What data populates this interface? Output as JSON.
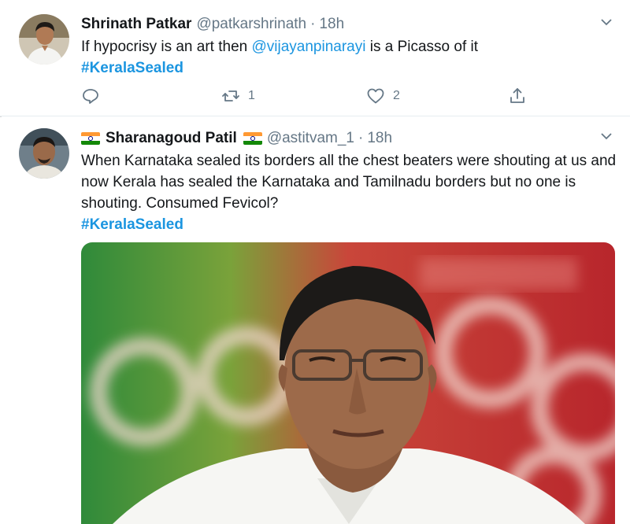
{
  "tweets": [
    {
      "name": "Shrinath Patkar",
      "handle": "@patkarshrinath",
      "separator": "·",
      "time": "18h",
      "text_before": "If hypocrisy is an art then ",
      "mention": "@vijayanpinarayi",
      "text_after": " is a Picasso of it",
      "hashtag": "#KeralaSealed",
      "retweets": "1",
      "likes": "2"
    },
    {
      "name": "Sharanagoud Patil",
      "handle": "@astitvam_1",
      "separator": "·",
      "time": "18h",
      "text": "When Karnataka sealed its borders all the chest beaters were shouting at us and now Kerala has sealed the Karnataka and Tamilnadu borders but no one is shouting. Consumed Fevicol?",
      "hashtag": "#KeralaSealed"
    }
  ],
  "icons": {
    "caret": "chevron-down-icon",
    "reply": "reply-icon",
    "retweet": "retweet-icon",
    "like": "heart-icon",
    "share": "share-icon",
    "flag": "india-flag-icon"
  },
  "colors": {
    "link": "#1b95e0",
    "muted": "#657786",
    "text": "#14171a",
    "divider": "#e6ecf0"
  }
}
